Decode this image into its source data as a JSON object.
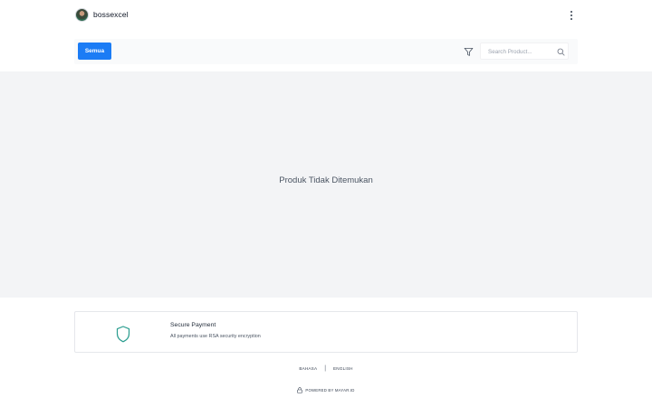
{
  "header": {
    "store_name": "bossexcel",
    "avatar_icon": "avatar-photo",
    "menu_icon": "kebab-menu-icon"
  },
  "toolbar": {
    "tabs": [
      {
        "label": "Semua",
        "active": true
      }
    ],
    "filter_icon": "filter-icon",
    "search": {
      "placeholder": "Search Product...",
      "value": "",
      "icon": "search-icon"
    },
    "accent_color": "#1b7cf5"
  },
  "main": {
    "empty_message": "Produk Tidak Ditemukan"
  },
  "secure": {
    "icon": "shield-icon",
    "title": "Secure Payment",
    "description": "All payments use RSA security encryption",
    "icon_color": "#2a9d8f"
  },
  "footer": {
    "languages": [
      "BAHASA",
      "ENGLISH"
    ],
    "separator": "|",
    "powered_by": "POWERED BY MAYAR.ID",
    "powered_icon": "lock-icon"
  }
}
